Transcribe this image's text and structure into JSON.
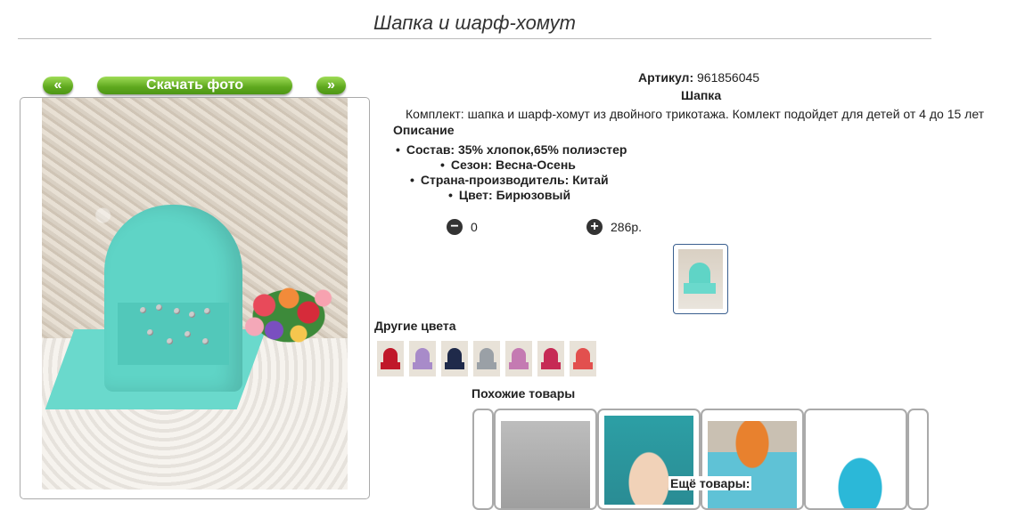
{
  "title": "Шапка и шарф-хомут",
  "gallery": {
    "prev_label": "«",
    "download_label": "Скачать фото",
    "next_label": "»"
  },
  "product": {
    "article_label": "Артикул:",
    "article_value": "961856045",
    "type": "Шапка",
    "description": "Комплект: шапка и шарф-хомут из двойного трикотажа. Комлект подойдет для детей от 4 до 15 лет",
    "description_title": "Описание",
    "properties": [
      "Состав: 35% хлопок,65% полиэстер",
      "Сезон: Весна-Осень",
      "Страна-производитель: Китай",
      "Цвет: Бирюзовый"
    ],
    "quantity": "0",
    "price": "286р."
  },
  "other_colors": {
    "title": "Другие цвета",
    "colors": [
      "#c0182a",
      "#a88bc9",
      "#1f2a4a",
      "#9aa0a6",
      "#c47ab2",
      "#c62a55",
      "#e2504e"
    ]
  },
  "similar": {
    "title": "Похожие товары",
    "more_label": "Ещё товары:"
  }
}
